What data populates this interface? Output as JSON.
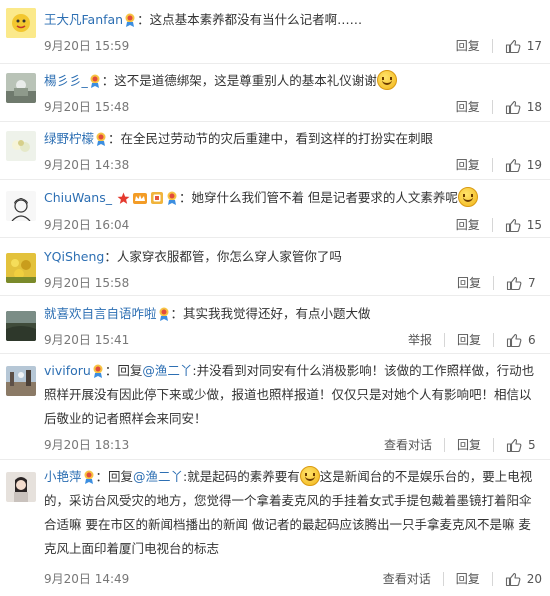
{
  "comments": [
    {
      "user": "王大凡Fanfan",
      "text": "：这点基本素养都没有当什么记者啊……",
      "time": "9月20日 15:59",
      "reply": "回复",
      "likes": "17",
      "avatar_color": "#f4d23a"
    },
    {
      "user": "楊彡彡_",
      "text": "：这不是道德绑架，这是尊重别人的基本礼仪谢谢",
      "time": "9月20日 15:48",
      "reply": "回复",
      "likes": "18",
      "avatar_color": "#9aa39a"
    },
    {
      "user": "绿野柠檬",
      "text": "：在全民过劳动节的灾后重建中，看到这样的打扮实在刺眼",
      "time": "9月20日 14:38",
      "reply": "回复",
      "likes": "19",
      "avatar_color": "#e9efe6"
    },
    {
      "user": "ChiuWans_",
      "text": "：她穿什么我们管不着 但是记者要求的人文素养呢",
      "time": "9月20日 16:04",
      "reply": "回复",
      "likes": "15",
      "avatar_color": "#f5f5f5"
    },
    {
      "user": "YQiSheng",
      "text": "：人家穿衣服都管，你怎么穿人家管你了吗",
      "time": "9月20日 15:58",
      "reply": "回复",
      "likes": "7",
      "avatar_color": "#d9b52b"
    },
    {
      "user": "就喜欢自言自语咋啦",
      "text": "：其实我我觉得还好，有点小题大做",
      "time": "9月20日 15:41",
      "report": "举报",
      "reply": "回复",
      "likes": "6",
      "avatar_color": "#3d4a3a"
    },
    {
      "user": "viviforu",
      "reply_prefix": "：回复",
      "mention": "@渔二丫",
      "text": ":并没看到对同安有什么消极影响！该做的工作照样做，行动也照样开展没有因此停下来或少做，报道也照样报道！仅仅只是对她个人有影响吧！相信以后敬业的记者照样会来同安！",
      "time": "9月20日 18:13",
      "view_conversation": "查看对话",
      "reply": "回复",
      "likes": "5",
      "avatar_color": "#9fb5c9"
    },
    {
      "user": "小艳萍",
      "reply_prefix": "：回复",
      "mention": "@渔二丫",
      "text_a": ":就是起码的素养要有",
      "text_b": "这是新闻台的不是娱乐台的，要上电视的，采访台风受灾的地方，您觉得一个拿着麦克风的手挂着女式手提包戴着墨镜打着阳伞合适嘛 要在市区的新闻档播出的新闻 做记者的最起码应该腾出一只手拿麦克风不是嘛 麦克风上面印着厦门电视台的标志",
      "time": "9月20日 14:49",
      "view_conversation": "查看对话",
      "reply": "回复",
      "likes": "20",
      "avatar_color": "#ddd8d4"
    }
  ]
}
